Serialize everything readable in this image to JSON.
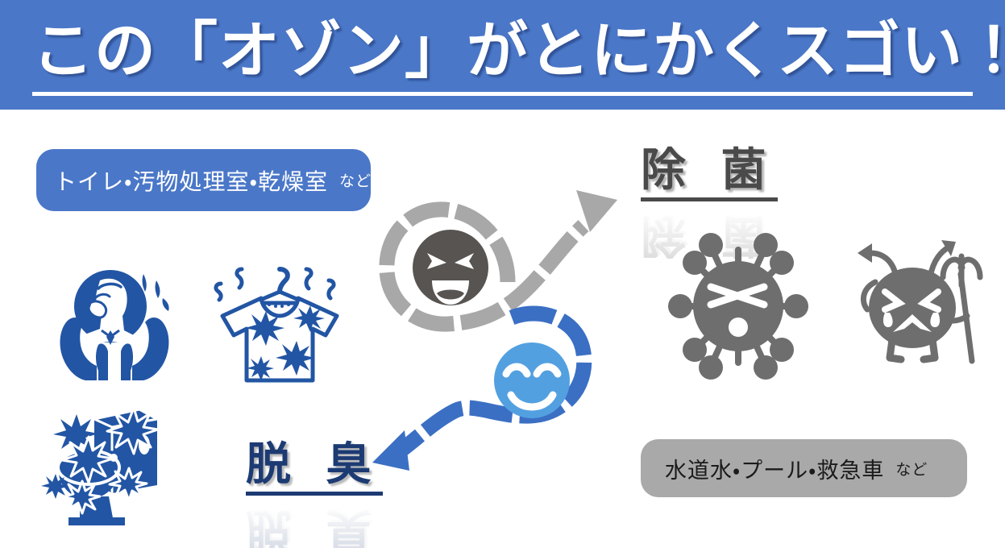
{
  "slide": {
    "title": "この「オゾン」がとにかくスゴい！",
    "background_color": "#ffffff"
  },
  "banner": {
    "background_color": "#4a77c8",
    "text_color": "#ffffff"
  },
  "chips": {
    "deodorize": {
      "main": "トイレ・汚物処理室・乾燥室",
      "sub": "など",
      "background_color": "#4a77c8",
      "text_color": "#ffffff"
    },
    "sterilize": {
      "main": "水道水・プール・救急車",
      "sub": "など",
      "background_color": "#a9a9a9",
      "text_color": "#1b1b1b"
    }
  },
  "headings": {
    "sterilize": {
      "text": "除 菌",
      "color": "#4a4a4a"
    },
    "deodorize": {
      "text": "脱 臭",
      "color": "#1d3b73"
    }
  },
  "icons": {
    "nose_pinch": "person-pinching-nose-in-hands-icon",
    "tshirt": "smelly-tshirt-on-hanger-icon",
    "toilet": "germy-toilet-icon",
    "virus": "defeated-virus-icon",
    "germ": "crying-germ-with-pitchfork-icon",
    "diagram": "s-curve-dual-arrow-diagram",
    "happy_face_gray": "grinning-face-dark-gray",
    "happy_face_blue": "smiling-face-light-blue"
  },
  "colors": {
    "brand_blue": "#4a77c8",
    "icon_navy": "#2255a4",
    "arrow_blue": "#3b6fc4",
    "arrow_gray": "#a8a8a8",
    "face_dark": "#575451",
    "face_blue": "#53a0e0",
    "germ_gray": "#6e6e6e",
    "chip_gray": "#a9a9a9"
  }
}
